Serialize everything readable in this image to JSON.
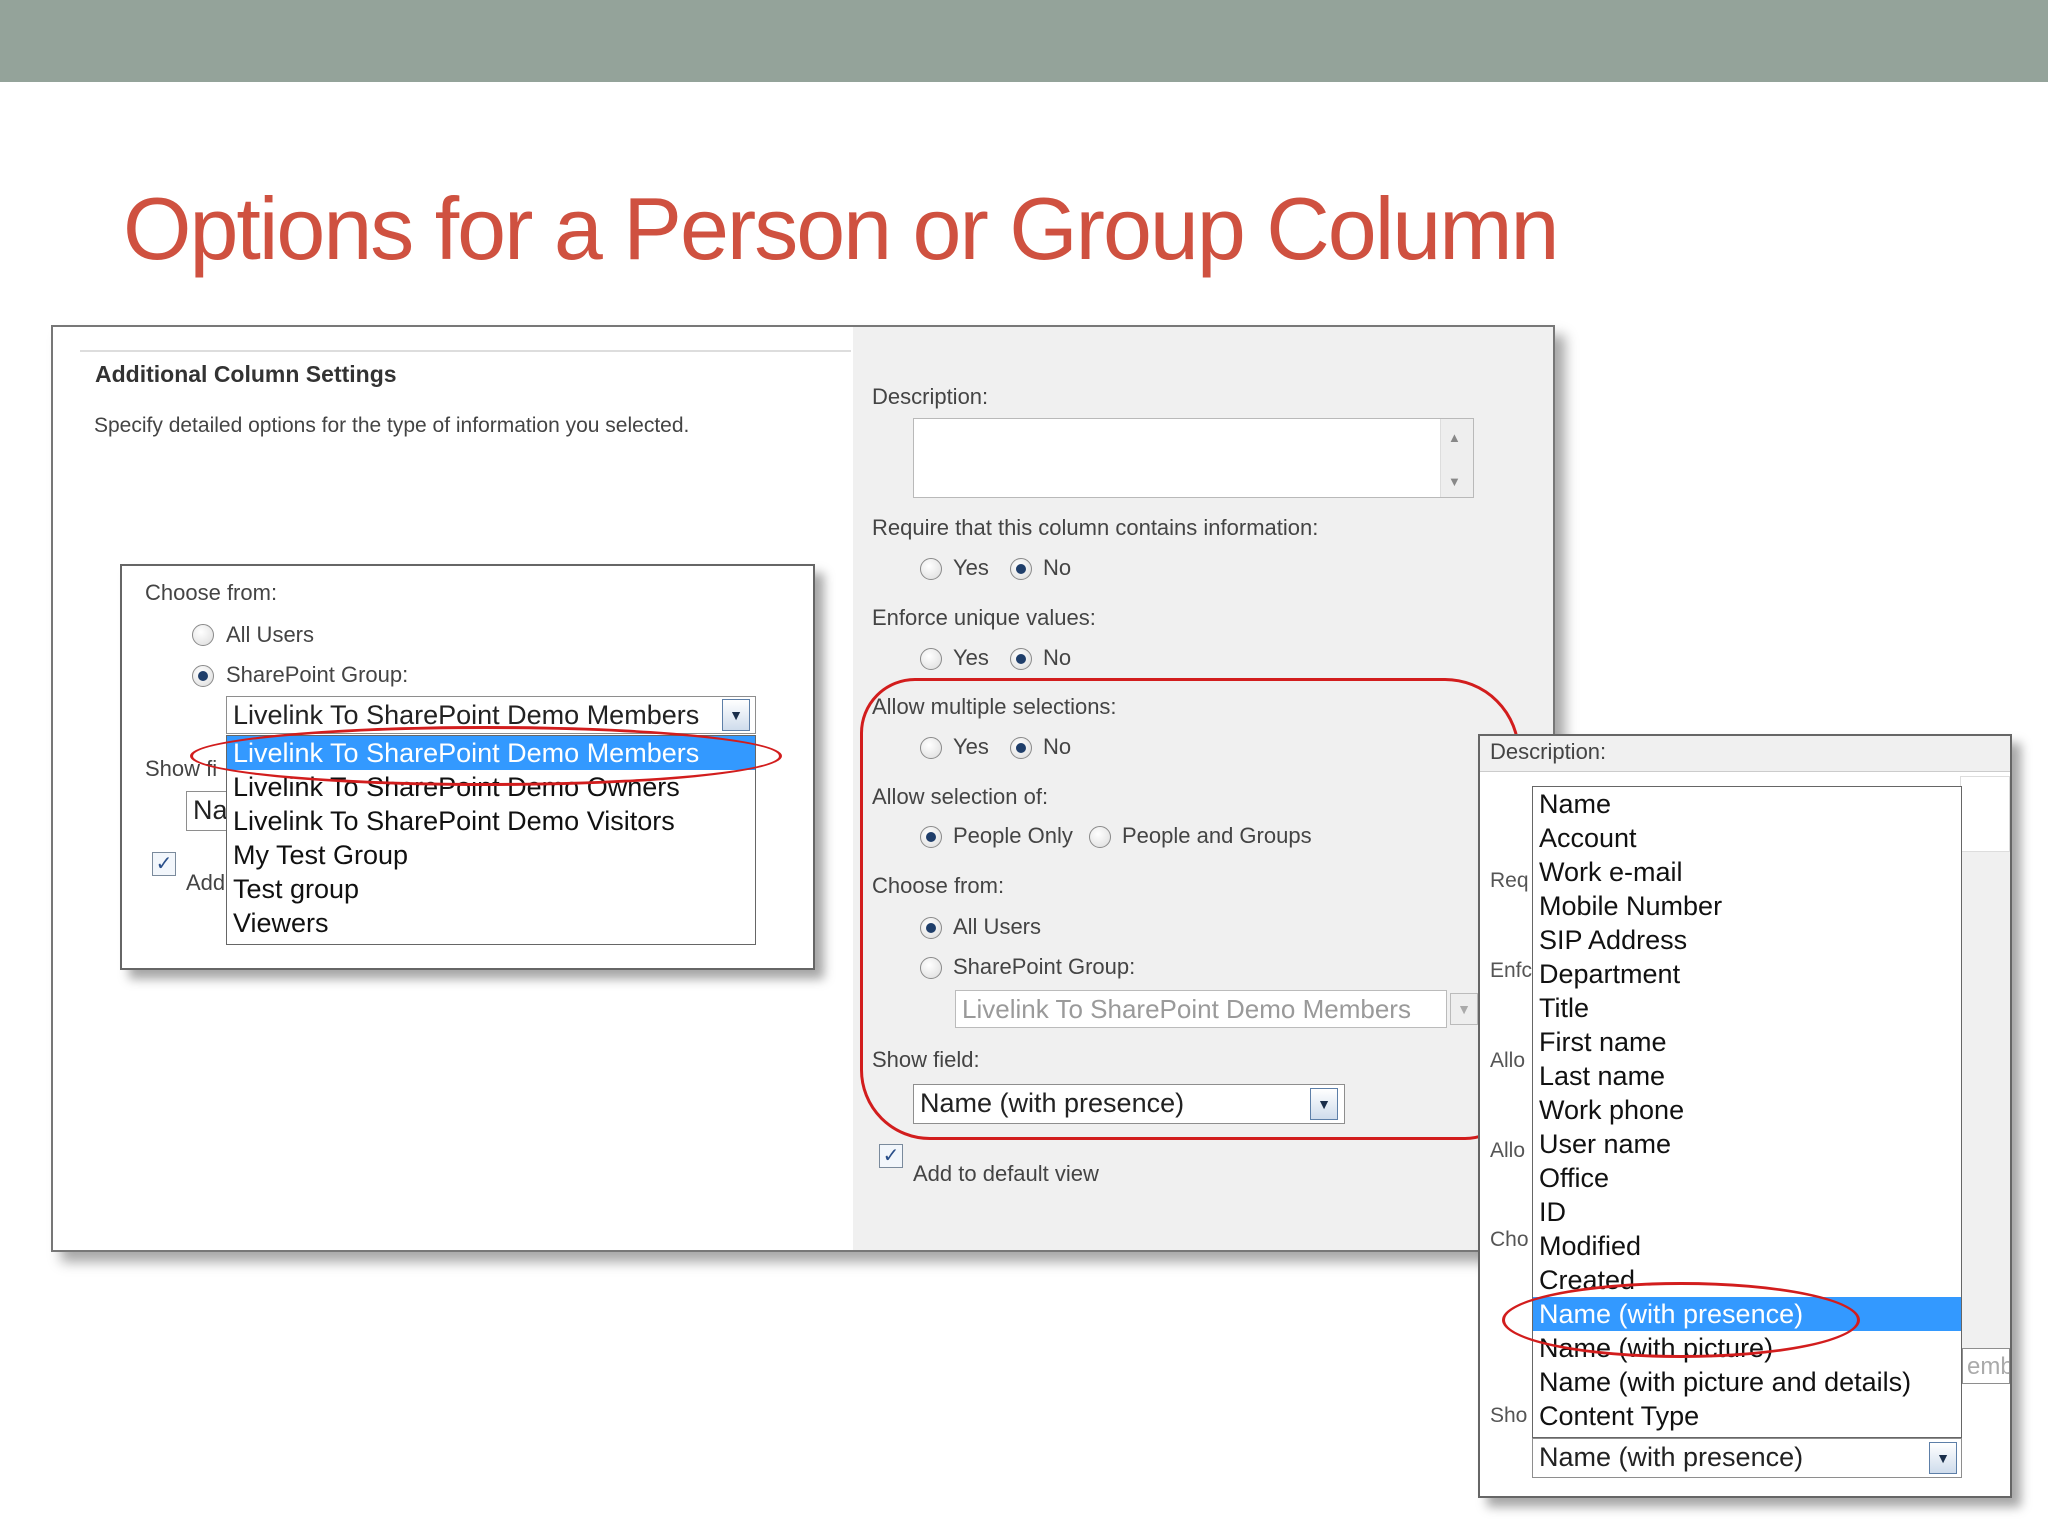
{
  "slide": {
    "title": "Options for a Person or Group Column"
  },
  "section": {
    "title": "Additional Column Settings",
    "subtitle": "Specify detailed options for the type of information you selected."
  },
  "form": {
    "description_label": "Description:",
    "required": {
      "label": "Require that this column contains information:",
      "yes": "Yes",
      "no": "No",
      "selected": "No"
    },
    "unique": {
      "label": "Enforce unique values:",
      "yes": "Yes",
      "no": "No",
      "selected": "No"
    },
    "multiple": {
      "label": "Allow multiple selections:",
      "yes": "Yes",
      "no": "No",
      "selected": "No"
    },
    "allow_selection": {
      "label": "Allow selection of:",
      "people_only": "People Only",
      "people_groups": "People and Groups",
      "selected": "People Only"
    },
    "choose_from": {
      "label": "Choose from:",
      "all_users": "All Users",
      "sharepoint_group": "SharePoint Group:",
      "selected": "All Users"
    },
    "group_select_value": "Livelink To SharePoint Demo Members",
    "show_field": {
      "label": "Show field:",
      "value": "Name (with presence)"
    },
    "add_default": {
      "label": "Add to default view",
      "checked": true
    }
  },
  "left_popup": {
    "choose_from": "Choose from:",
    "all_users": "All Users",
    "sharepoint_group": "SharePoint Group:",
    "select_value": "Livelink To SharePoint Demo Members",
    "show_label_partial": "Show fi",
    "name_partial": "Na",
    "add_partial": "Add",
    "options": [
      "Livelink To SharePoint Demo Members",
      "Livelink To SharePoint Demo Owners",
      "Livelink To SharePoint Demo Visitors",
      "My Test Group",
      "Test group",
      "Viewers"
    ],
    "selected_index": 0
  },
  "right_popup": {
    "description_label": "Description:",
    "partials": [
      "Req",
      "Enfc",
      "Allo",
      "Allo",
      "Cho",
      "Sho"
    ],
    "partial_emb": "emb",
    "options": [
      "Name",
      "Account",
      "Work e-mail",
      "Mobile Number",
      "SIP Address",
      "Department",
      "Title",
      "First name",
      "Last name",
      "Work phone",
      "User name",
      "Office",
      "ID",
      "Modified",
      "Created",
      "Name (with presence)",
      "Name (with picture)",
      "Name (with picture and details)",
      "Content Type"
    ],
    "selected_index": 15,
    "select_value": "Name (with presence)"
  },
  "colors": {
    "title": "#cf5140",
    "band": "#94a39a",
    "highlight": "#3399ff",
    "annotation": "#d21d1d"
  }
}
